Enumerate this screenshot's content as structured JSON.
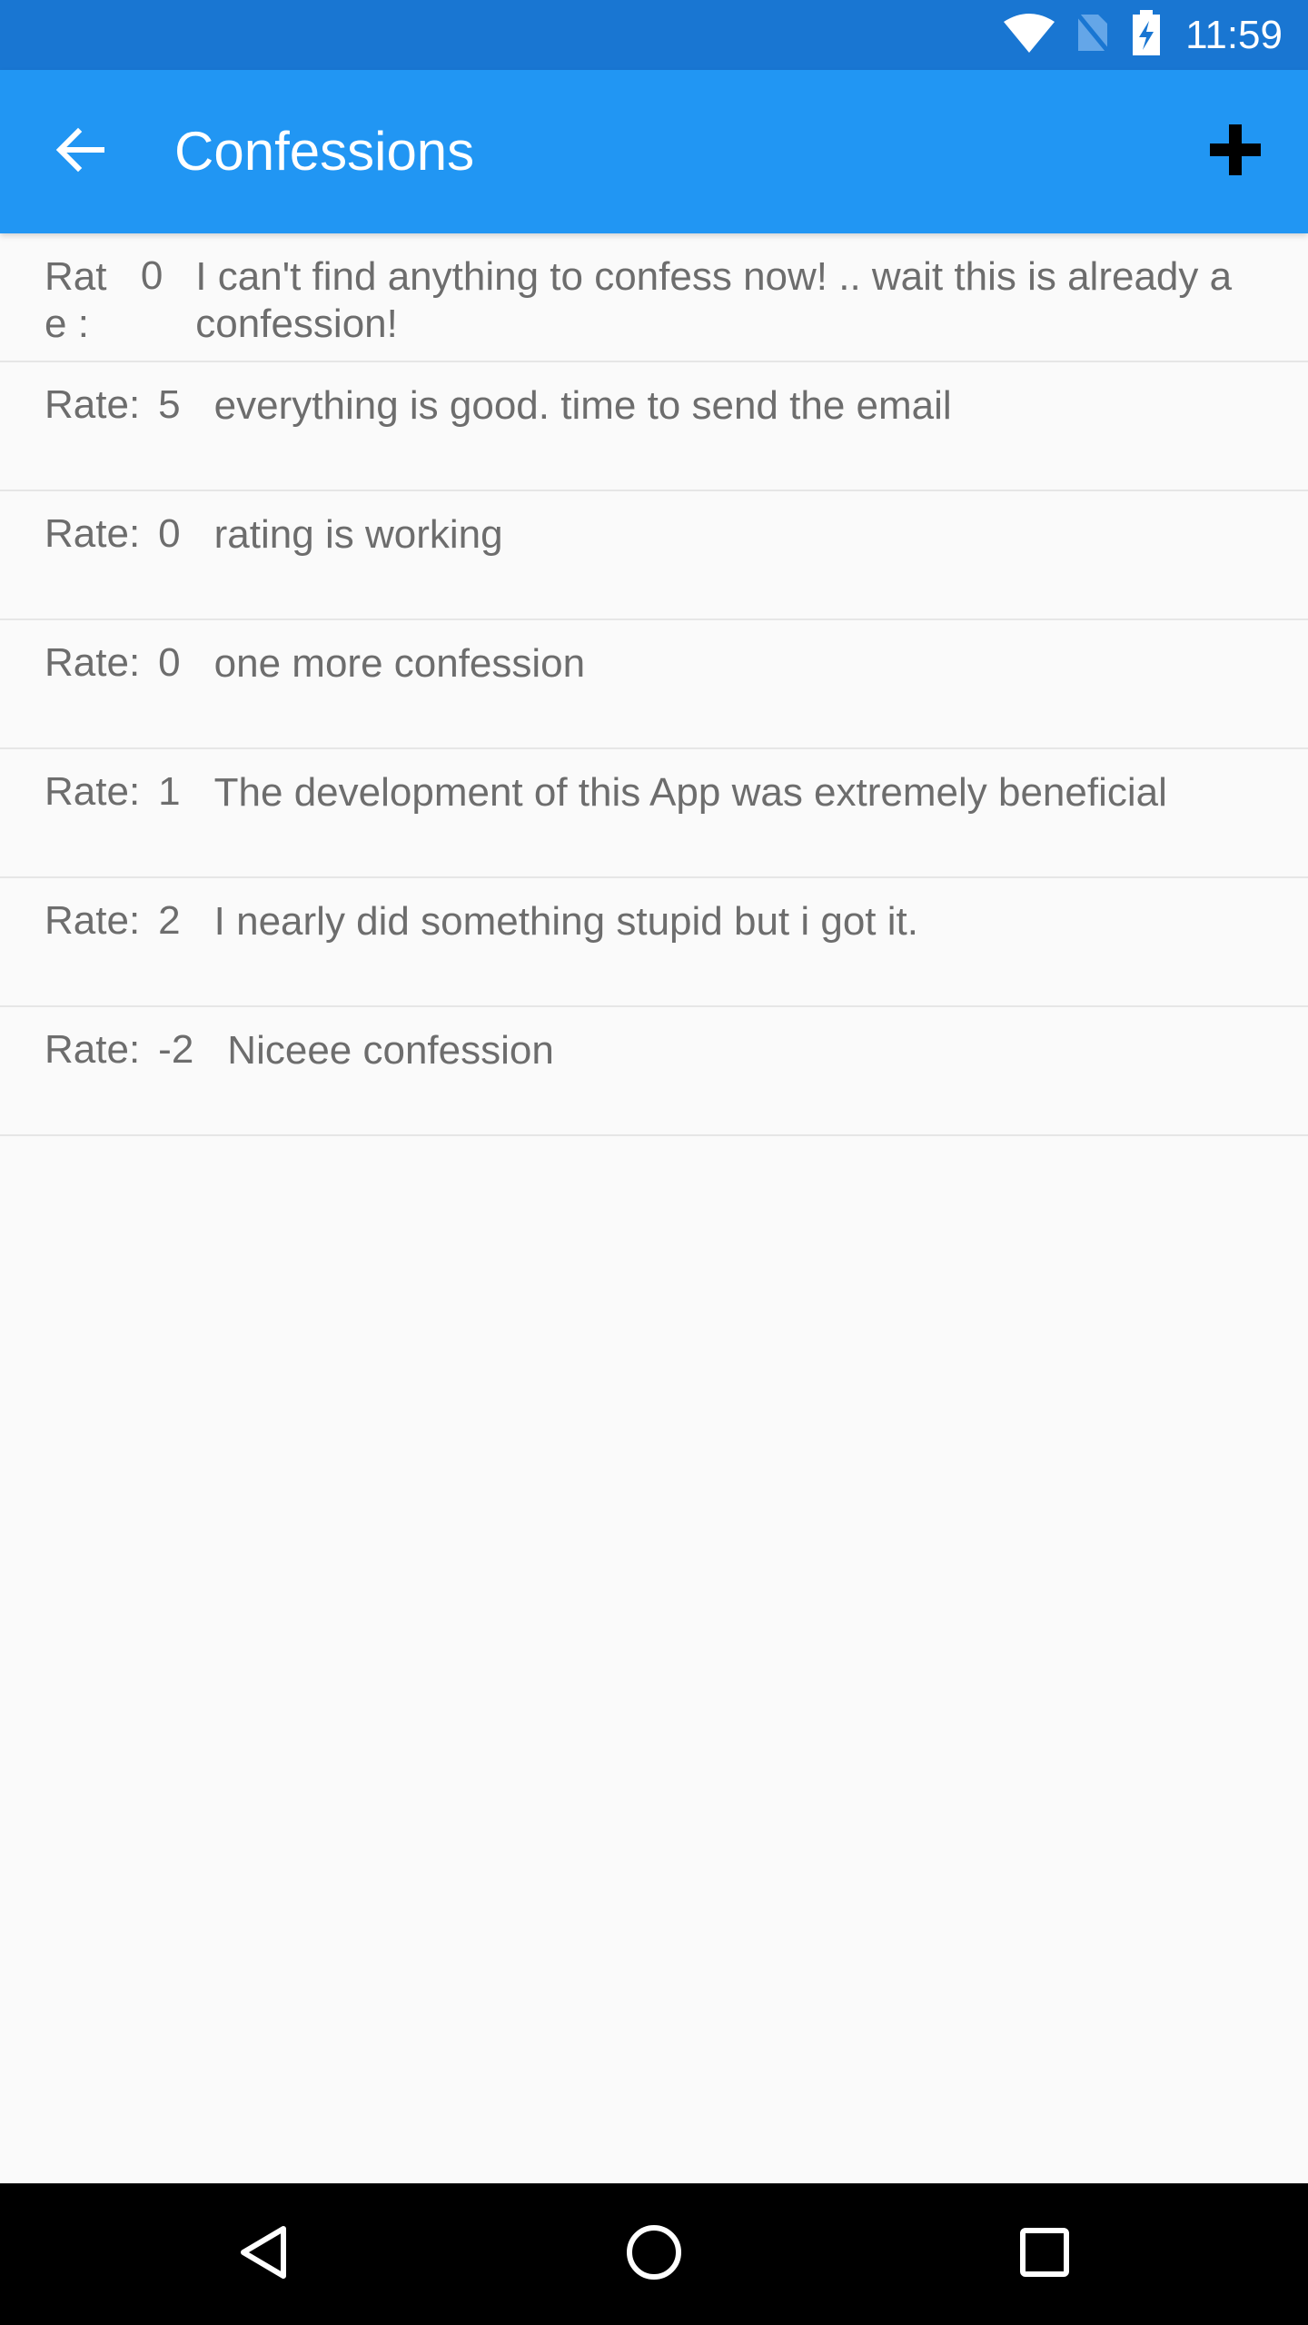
{
  "status_bar": {
    "time": "11:59",
    "icons": [
      "wifi-icon",
      "no-sim-icon",
      "battery-charging-icon"
    ]
  },
  "app_bar": {
    "title": "Confessions",
    "back_icon": "arrow-back-icon",
    "add_icon": "plus-icon"
  },
  "confessions": [
    {
      "rate_label": "Rate :",
      "rate": "0",
      "text": "I can't find anything to confess now! .. wait this is already a confession!"
    },
    {
      "rate_label": "Rate:",
      "rate": "5",
      "text": "everything is good. time to send the email"
    },
    {
      "rate_label": "Rate:",
      "rate": "0",
      "text": "rating is working"
    },
    {
      "rate_label": "Rate:",
      "rate": "0",
      "text": "one more confession"
    },
    {
      "rate_label": "Rate:",
      "rate": "1",
      "text": "The development of this App was extremely beneficial"
    },
    {
      "rate_label": "Rate:",
      "rate": "2",
      "text": "I nearly did something stupid but i got it."
    },
    {
      "rate_label": "Rate:",
      "rate": "-2",
      "text": "Niceee confession"
    }
  ],
  "nav_bar": {
    "icons": [
      "back-triangle-icon",
      "home-circle-icon",
      "recents-square-icon"
    ]
  },
  "colors": {
    "status_bar": "#1976d2",
    "app_bar": "#2196f3",
    "background": "#fafafa",
    "text": "#6d6d6d",
    "divider": "#e6e6e6"
  }
}
